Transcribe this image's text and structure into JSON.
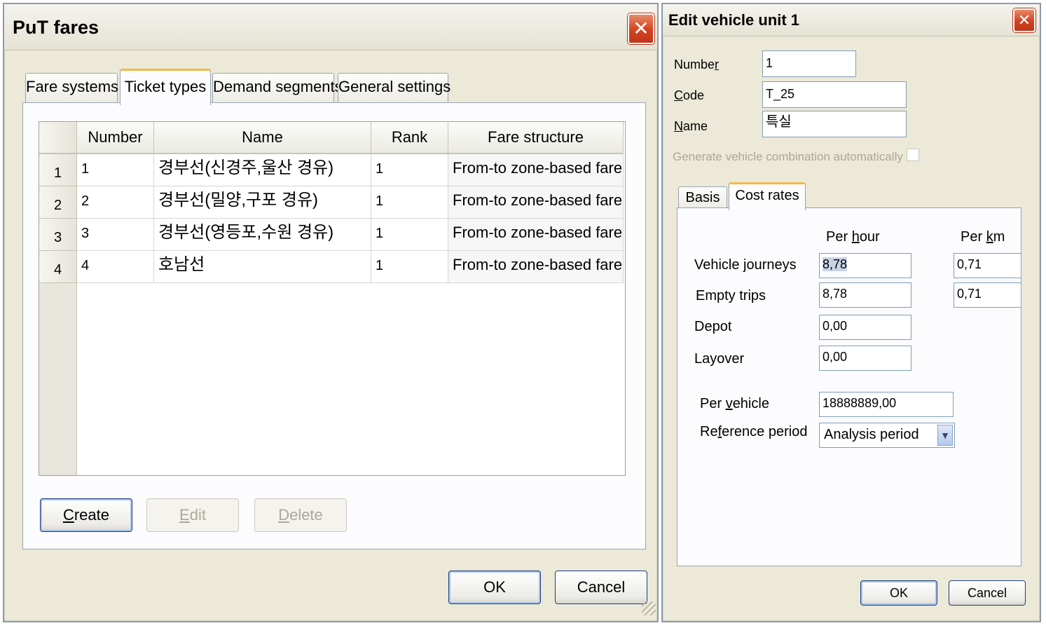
{
  "fares_window": {
    "title": "PuT fares",
    "close_glyph": "✕",
    "tabs": [
      "Fare systems",
      "Ticket types",
      "Demand segments",
      "General settings"
    ],
    "active_tab": "Ticket types",
    "table": {
      "columns": [
        "Number",
        "Name",
        "Rank",
        "Fare structure"
      ],
      "rows": [
        {
          "index": "1",
          "number": "1",
          "name": "경부선(신경주,울산 경유)",
          "rank": "1",
          "fare_structure": "From-to zone-based fare"
        },
        {
          "index": "2",
          "number": "2",
          "name": "경부선(밀양,구포 경유)",
          "rank": "1",
          "fare_structure": "From-to zone-based fare"
        },
        {
          "index": "3",
          "number": "3",
          "name": "경부선(영등포,수원 경유)",
          "rank": "1",
          "fare_structure": "From-to zone-based fare"
        },
        {
          "index": "4",
          "number": "4",
          "name": "호남선",
          "rank": "1",
          "fare_structure": "From-to zone-based fare"
        }
      ]
    },
    "buttons": {
      "create_first": "C",
      "create_rest": "reate",
      "edit_first": "E",
      "edit_rest": "dit",
      "delete_first": "D",
      "delete_rest": "elete",
      "ok": "OK",
      "cancel": "Cancel"
    }
  },
  "vehicle_window": {
    "title": "Edit vehicle unit 1",
    "close_glyph": "✕",
    "number": {
      "label_pre": "Numbe",
      "label_key": "r",
      "value": "1"
    },
    "code": {
      "label_key": "C",
      "label_post": "ode",
      "value": "T_25"
    },
    "name": {
      "label_key": "N",
      "label_post": "ame",
      "value": "특실"
    },
    "generate_label": "Generate vehicle combination automatically",
    "generate_checked": false,
    "tabs": [
      "Basis",
      "Cost rates"
    ],
    "active_tab": "Cost rates",
    "per_hour_pre": "Per ",
    "per_hour_key": "h",
    "per_hour_post": "our",
    "per_km_pre": "Per ",
    "per_km_key": "k",
    "per_km_post": "m",
    "rows": [
      {
        "label": "Vehicle journeys",
        "per_hour": "8,78",
        "per_km": "0,71"
      },
      {
        "label": "Empty trips",
        "per_hour": "8,78",
        "per_km": "0,71"
      },
      {
        "label": "Depot",
        "per_hour": "0,00"
      },
      {
        "label": "Layover",
        "per_hour": "0,00"
      }
    ],
    "per_vehicle": {
      "label_pre": "Per ",
      "label_key": "v",
      "label_post": "ehicle",
      "value": "18888889,00"
    },
    "reference_period": {
      "label_pre": "Re",
      "label_key": "f",
      "label_post": "erence period",
      "value": "Analysis period"
    },
    "buttons": {
      "ok": "OK",
      "cancel": "Cancel"
    },
    "colors": {
      "selection": "#c8d4e6",
      "close_button": "#d2421e",
      "active_tab_accent": "#f7b846"
    }
  }
}
